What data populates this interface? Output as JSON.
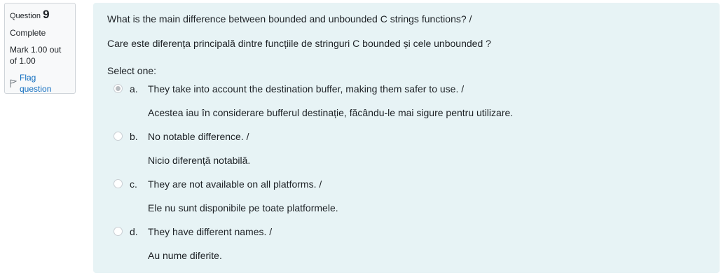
{
  "info": {
    "question_label": "Question",
    "question_number": "9",
    "state": "Complete",
    "mark": "Mark 1.00 out of 1.00",
    "flag_label": "Flag question"
  },
  "question": {
    "text_en": "What is the main difference between bounded and unbounded C strings functions? /",
    "text_ro": "Care este diferența principală dintre funcțiile de stringuri C bounded și cele unbounded ?",
    "prompt": "Select one:",
    "options": [
      {
        "letter": "a.",
        "en": "They take into account the destination buffer, making them safer to use. /",
        "ro": "Acestea iau în considerare bufferul destinație, făcându-le mai sigure pentru utilizare.",
        "selected": true
      },
      {
        "letter": "b.",
        "en": "No notable difference. /",
        "ro": "Nicio diferență notabilă.",
        "selected": false
      },
      {
        "letter": "c.",
        "en": "They are not available on all platforms. /",
        "ro": "Ele nu sunt disponibile pe toate platformele.",
        "selected": false
      },
      {
        "letter": "d.",
        "en": "They have different names. /",
        "ro": "Au nume diferite.",
        "selected": false
      }
    ]
  }
}
